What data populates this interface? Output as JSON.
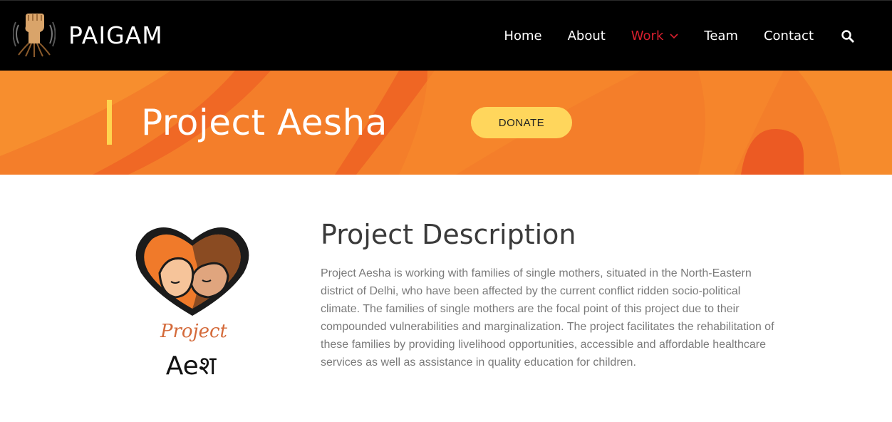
{
  "header": {
    "brand_name": "PAIGAM",
    "logo_icon": "raised-fist-logo",
    "nav": {
      "home": "Home",
      "about": "About",
      "work": "Work",
      "team": "Team",
      "contact": "Contact"
    },
    "active_nav_color": "#d81f2e",
    "search_icon": "search-icon"
  },
  "banner": {
    "title": "Project Aesha",
    "donate_label": "DONATE",
    "background_color": "#f47e2a",
    "accent_color": "#ffd54f"
  },
  "content": {
    "logo": {
      "script_text": "Project",
      "bottom_text": "Aeश"
    },
    "heading": "Project Description",
    "description": "Project Aesha is working with families of single mothers, situated in the North-Eastern district of Delhi, who have been affected by the current conflict ridden socio-political climate. The families of single mothers are the focal point of this project due to their compounded vulnerabilities and marginalization. The project facilitates the rehabilitation of these families by providing livelihood opportunities, accessible and affordable healthcare services as well as assistance in quality education for children."
  }
}
